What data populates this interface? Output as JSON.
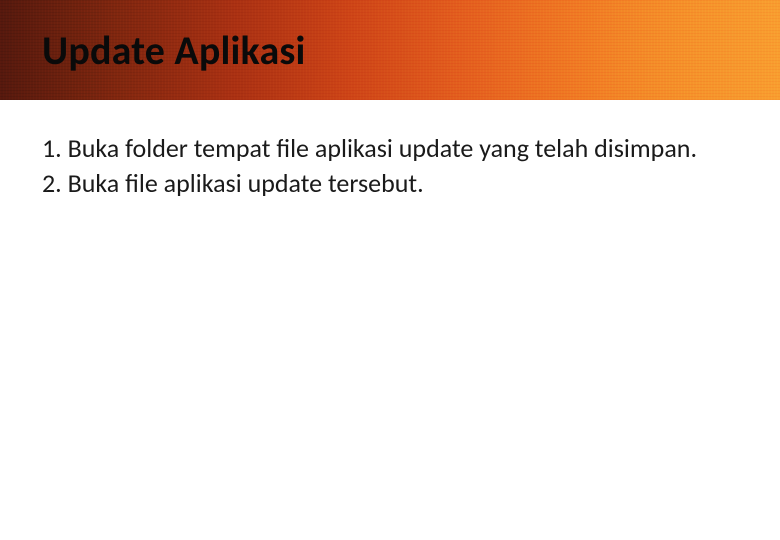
{
  "header": {
    "title": "Update Aplikasi"
  },
  "body": {
    "items": [
      "1. Buka folder tempat file aplikasi update yang telah disimpan.",
      "2. Buka file aplikasi update tersebut."
    ]
  }
}
